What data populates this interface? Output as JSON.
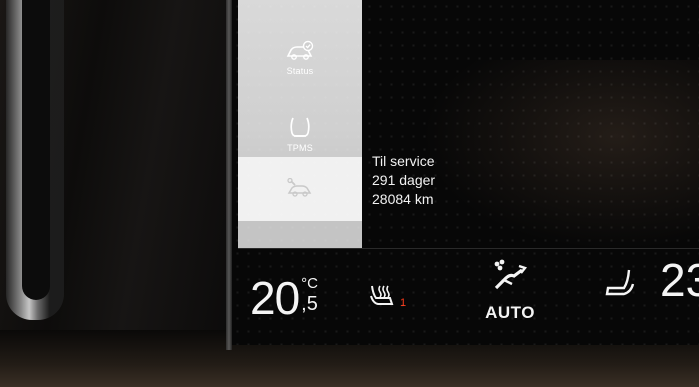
{
  "side_menu": {
    "items": [
      {
        "label": "Status",
        "icon": "car-status-icon"
      },
      {
        "label": "TPMS",
        "icon": "tire-pressure-icon"
      },
      {
        "label": "",
        "icon": "service-wrench-car-icon",
        "selected": true
      }
    ]
  },
  "service": {
    "title": "Til service",
    "days": "291 dager",
    "distance": "28084 km"
  },
  "climate": {
    "driver_temp_whole": "20",
    "driver_temp_unit": "°C",
    "driver_temp_decimal": ",5",
    "seat_heat_level": "1",
    "auto_label": "AUTO",
    "passenger_temp": "23",
    "seat_heat_color": "#ff3b1a"
  }
}
